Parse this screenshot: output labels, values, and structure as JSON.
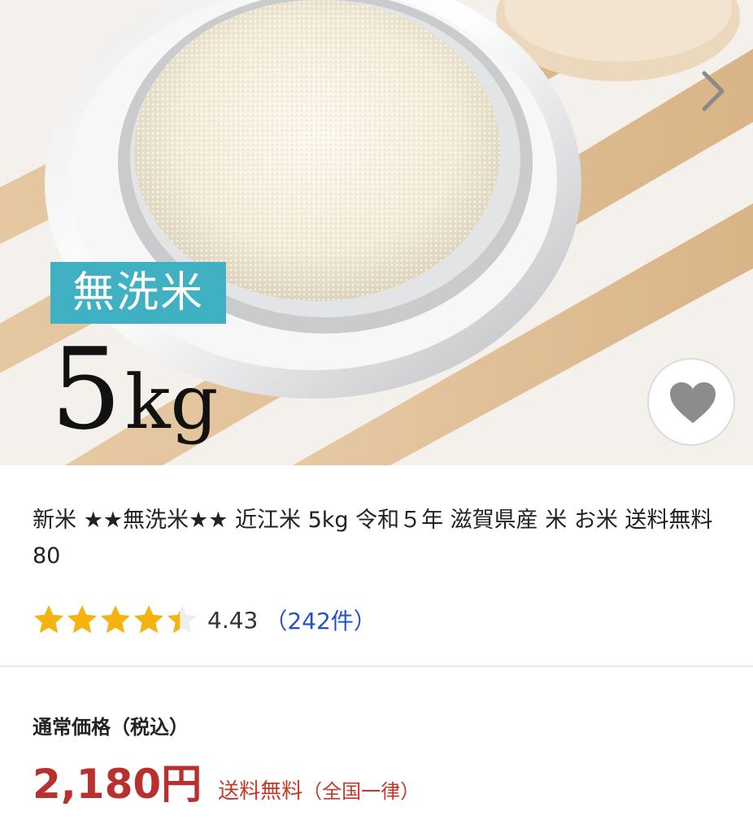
{
  "product_image": {
    "badge_text": "無洗米",
    "weight_number": "5",
    "weight_unit": "kg",
    "next_icon": "chevron-right-icon",
    "favorite_icon": "heart-icon"
  },
  "product": {
    "title": "新米 ★★無洗米★★ 近江米 5kg 令和５年 滋賀県産 米 お米 送料無料 80",
    "rating": {
      "value": "4.43",
      "count": "（242件）",
      "stars_filled": 4.43,
      "stars_max": 5
    }
  },
  "pricing": {
    "label": "通常価格（税込）",
    "price": "2,180円",
    "shipping": "送料無料",
    "shipping_note": "（全国一律）"
  },
  "colors": {
    "star": "#f5b30f",
    "price": "#b8312f",
    "link": "#2451c8",
    "badge": "#3fb1c3"
  }
}
